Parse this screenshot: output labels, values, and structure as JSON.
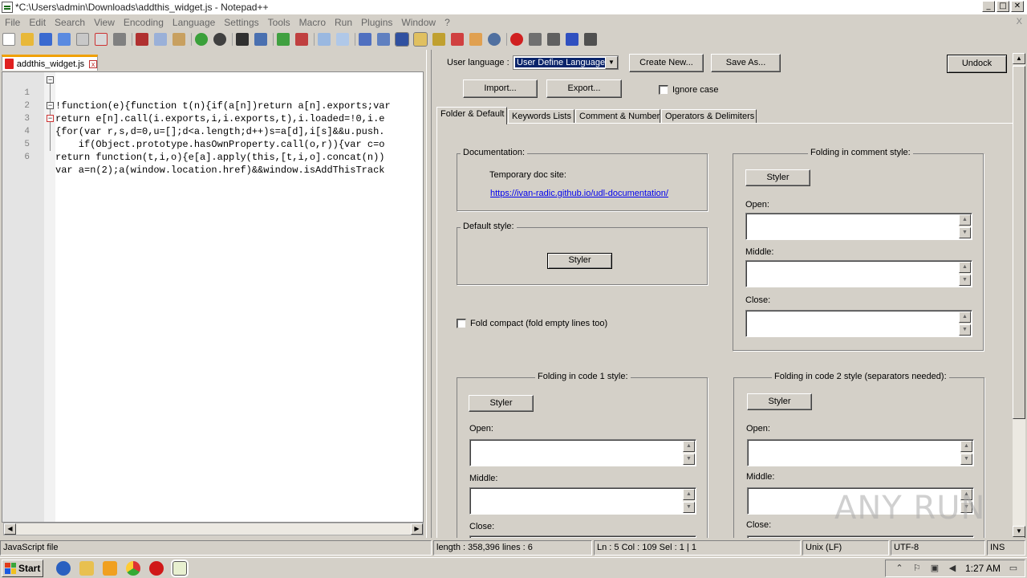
{
  "window": {
    "title": "*C:\\Users\\admin\\Downloads\\addthis_widget.js - Notepad++",
    "min": "_",
    "max": "□",
    "close": "✕"
  },
  "menu": [
    "File",
    "Edit",
    "Search",
    "View",
    "Encoding",
    "Language",
    "Settings",
    "Tools",
    "Macro",
    "Run",
    "Plugins",
    "Window",
    "?"
  ],
  "menu_close": "X",
  "file_tab": {
    "name": "addthis_widget.js",
    "close": "x"
  },
  "editor": {
    "line_numbers": [
      "1",
      "2",
      "3",
      "4",
      "5",
      "6"
    ],
    "lines": [
      "!function(e){function t(n){if(a[n])return a[n].exports;var",
      "return e[n].call(i.exports,i,i.exports,t),i.loaded=!0,i.e",
      "{for(var r,s,d=0,u=[];d<a.length;d++)s=a[d],i[s]&&u.push.",
      "    if(Object.prototype.hasOwnProperty.call(o,r)){var c=o",
      "return function(t,i,o){e[a].apply(this,[t,i,o].concat(n))",
      "var a=n(2);a(window.location.href)&&window.isAddThisTrack"
    ]
  },
  "udl": {
    "user_language_label": "User language :",
    "user_language_value": "User Define Language",
    "create_new": "Create New...",
    "save_as": "Save As...",
    "undock": "Undock",
    "import": "Import...",
    "export": "Export...",
    "ignore_case": "Ignore case",
    "tabs": [
      "Folder & Default",
      "Keywords Lists",
      "Comment & Number",
      "Operators & Delimiters"
    ],
    "documentation": {
      "title": "Documentation:",
      "temp_site": "Temporary doc site:",
      "link": "https://ivan-radic.github.io/udl-documentation/"
    },
    "default_style": {
      "title": "Default style:",
      "styler": "Styler"
    },
    "fold_compact": "Fold compact (fold empty lines too)",
    "folding_comment": {
      "title": "Folding in comment style:",
      "styler": "Styler",
      "open": "Open:",
      "middle": "Middle:",
      "close": "Close:"
    },
    "folding_code1": {
      "title": "Folding in code 1 style:",
      "styler": "Styler",
      "open": "Open:",
      "middle": "Middle:",
      "close": "Close:"
    },
    "folding_code2": {
      "title": "Folding in code 2 style (separators needed):",
      "styler": "Styler",
      "open": "Open:",
      "middle": "Middle:",
      "close": "Close:"
    }
  },
  "status": {
    "type": "JavaScript file",
    "length": "length : 358,396    lines : 6",
    "pos": "Ln : 5    Col : 109    Sel : 1 | 1",
    "eol": "Unix (LF)",
    "encoding": "UTF-8",
    "mode": "INS"
  },
  "taskbar": {
    "start": "Start",
    "time": "1:27 AM"
  },
  "watermark": "ANY RUN"
}
